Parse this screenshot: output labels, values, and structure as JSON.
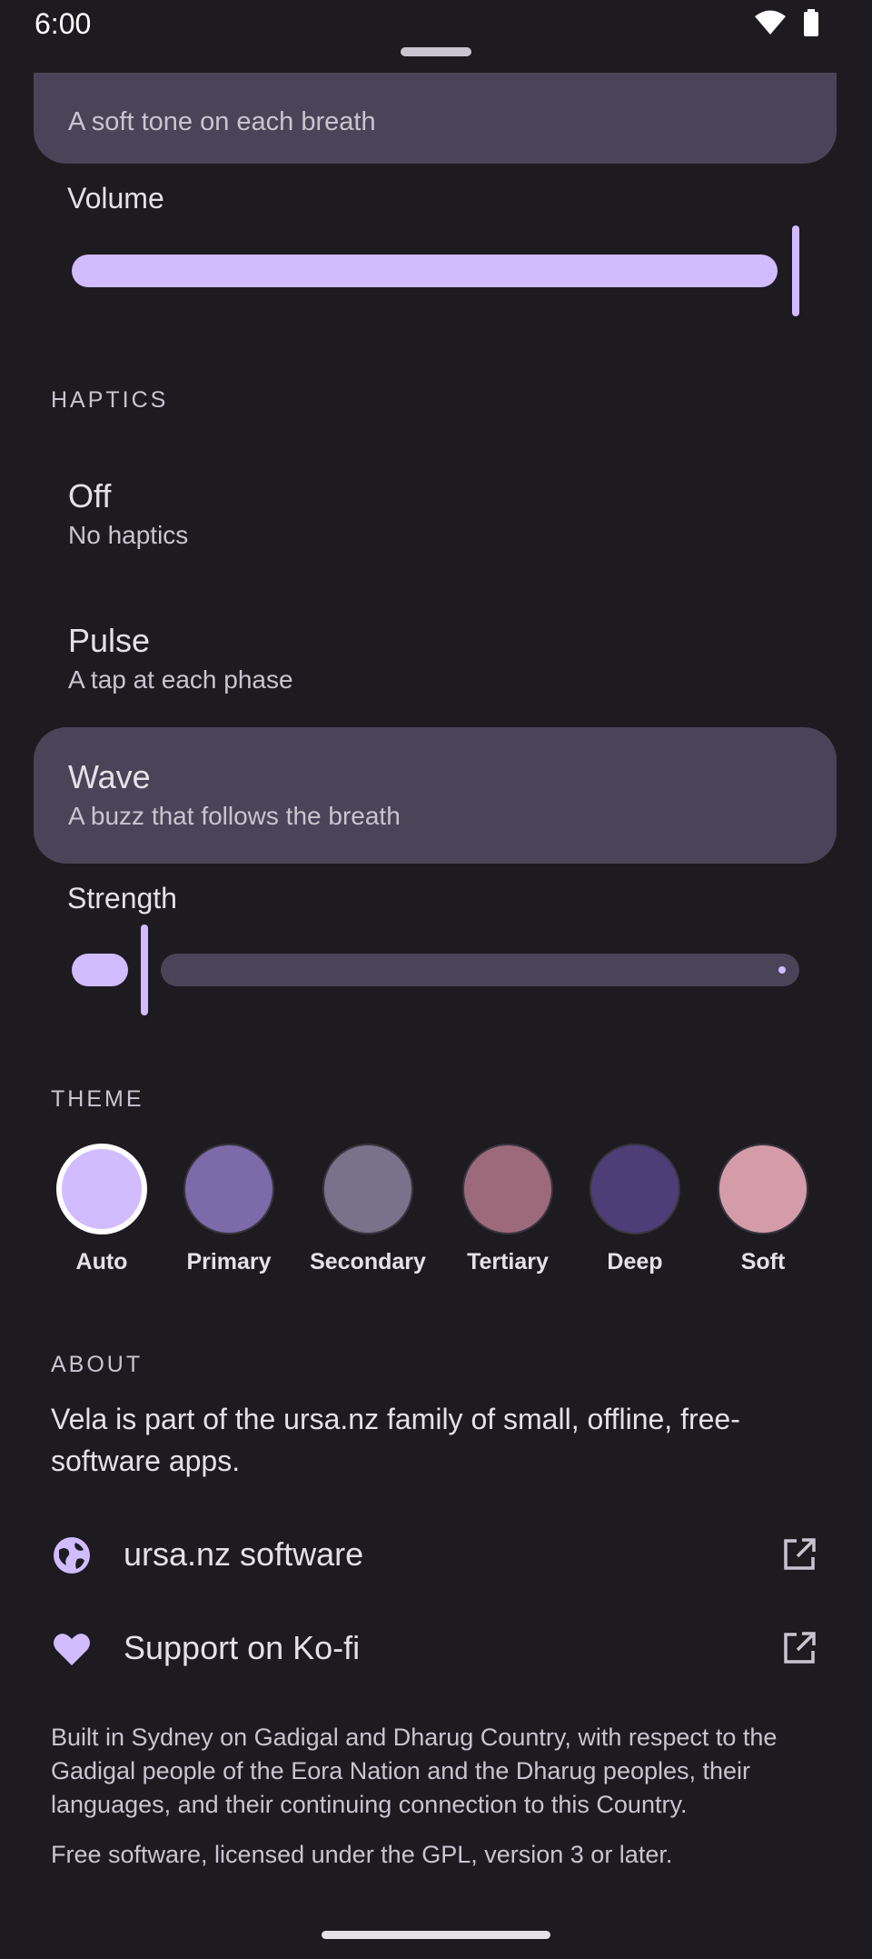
{
  "status": {
    "time": "6:00"
  },
  "sound_card": {
    "subtitle": "A soft tone on each breath"
  },
  "volume": {
    "label": "Volume",
    "level": 0.98
  },
  "haptics": {
    "header": "HAPTICS",
    "options": [
      {
        "title": "Off",
        "desc": "No haptics",
        "selected": false
      },
      {
        "title": "Pulse",
        "desc": "A tap at each phase",
        "selected": false
      },
      {
        "title": "Wave",
        "desc": "A buzz that follows the breath",
        "selected": true
      }
    ],
    "strength_label": "Strength",
    "strength_level": 0.1
  },
  "theme": {
    "header": "THEME",
    "swatches": [
      {
        "name": "Auto",
        "color": "#d0bcff",
        "selected": true
      },
      {
        "name": "Primary",
        "color": "#7d6aa8",
        "selected": false
      },
      {
        "name": "Secondary",
        "color": "#7a728a",
        "selected": false
      },
      {
        "name": "Tertiary",
        "color": "#9d6a7b",
        "selected": false
      },
      {
        "name": "Deep",
        "color": "#4e3e78",
        "selected": false
      },
      {
        "name": "Soft",
        "color": "#d49ca9",
        "selected": false
      }
    ]
  },
  "about": {
    "header": "ABOUT",
    "text": "Vela is part of the ursa.nz family of small, offline, free-software apps.",
    "links": [
      {
        "label": "ursa.nz software",
        "icon": "globe-icon"
      },
      {
        "label": "Support on Ko-fi",
        "icon": "heart-icon"
      }
    ],
    "acknowledgement": "Built in Sydney on Gadigal and Dharug Country, with respect to the Gadigal people of the Eora Nation and the Dharug peoples, their languages, and their continuing connection to this Country.",
    "license": "Free software, licensed under the GPL, version 3 or later."
  },
  "colors": {
    "accent": "#d0bcff",
    "surface": "#1d1b20",
    "selected_surface": "#4a4458"
  }
}
